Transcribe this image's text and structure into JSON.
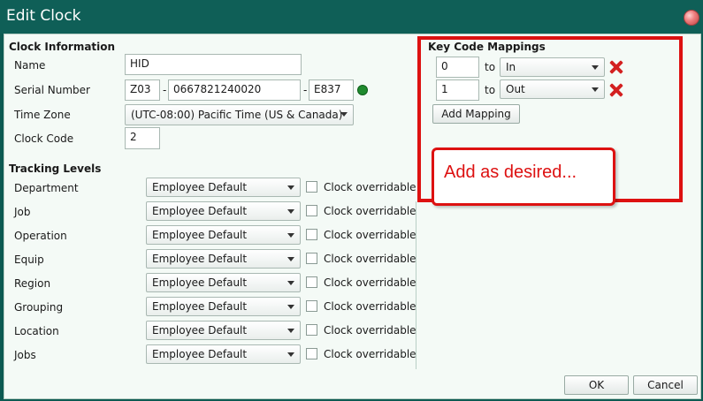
{
  "window": {
    "title": "Edit Clock"
  },
  "clock_info": {
    "section_title": "Clock Information",
    "name_label": "Name",
    "name_value": "HID",
    "serial_label": "Serial Number",
    "serial_part1": "Z03",
    "serial_part2": "0667821240020",
    "serial_part3": "E837",
    "serial_sep": "-",
    "timezone_label": "Time Zone",
    "timezone_value": "(UTC-08:00) Pacific Time (US & Canada)",
    "clockcode_label": "Clock Code",
    "clockcode_value": "2"
  },
  "tracking": {
    "section_title": "Tracking Levels",
    "checkbox_label": "Clock overridable",
    "rows": [
      {
        "label": "Department",
        "value": "Employee Default"
      },
      {
        "label": "Job",
        "value": "Employee Default"
      },
      {
        "label": "Operation",
        "value": "Employee Default"
      },
      {
        "label": "Equip",
        "value": "Employee Default"
      },
      {
        "label": "Region",
        "value": "Employee Default"
      },
      {
        "label": "Grouping",
        "value": "Employee Default"
      },
      {
        "label": "Location",
        "value": "Employee Default"
      },
      {
        "label": "Jobs",
        "value": "Employee Default"
      }
    ]
  },
  "mappings": {
    "section_title": "Key Code Mappings",
    "to_label": "to",
    "items": [
      {
        "code": "0",
        "value": "In"
      },
      {
        "code": "1",
        "value": "Out"
      }
    ],
    "add_label": "Add Mapping"
  },
  "annotation": {
    "text": "Add as desired...",
    "color": "#dd1111"
  },
  "buttons": {
    "ok": "OK",
    "cancel": "Cancel"
  }
}
